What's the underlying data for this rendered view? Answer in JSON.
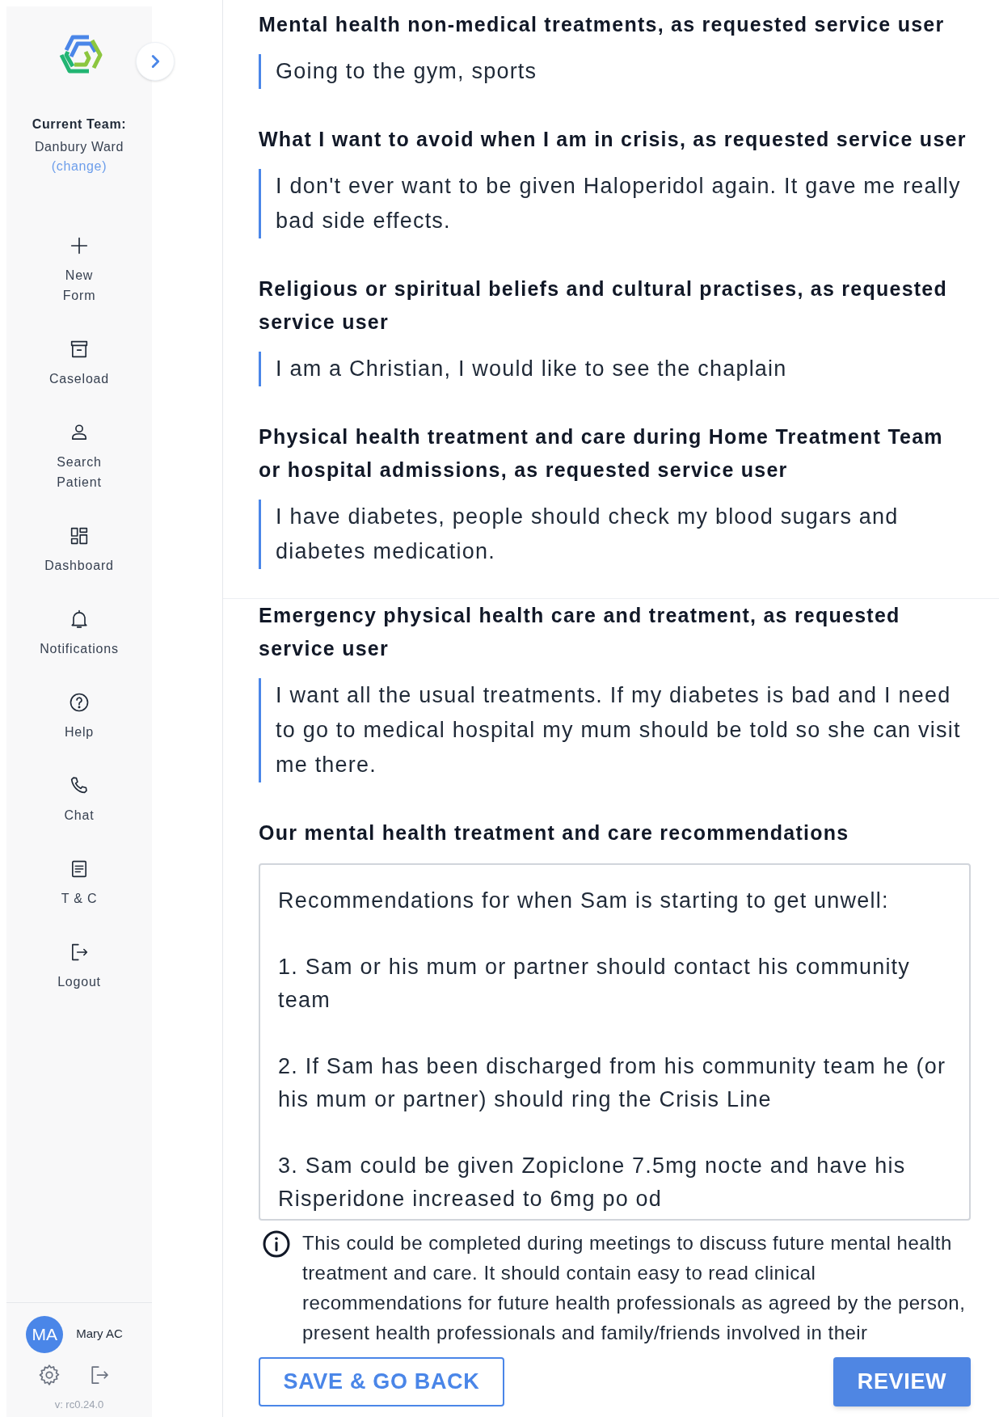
{
  "sidebar": {
    "team_label": "Current Team:",
    "team_name": "Danbury Ward",
    "change_link": "(change)",
    "nav": [
      {
        "kind": "plus",
        "lines": [
          "New",
          "Form"
        ]
      },
      {
        "kind": "archive",
        "lines": [
          "Caseload"
        ]
      },
      {
        "kind": "user",
        "lines": [
          "Search",
          "Patient"
        ]
      },
      {
        "kind": "dashboard",
        "lines": [
          "Dashboard"
        ]
      },
      {
        "kind": "bell",
        "lines": [
          "Notifications"
        ]
      },
      {
        "kind": "help",
        "lines": [
          "Help"
        ]
      },
      {
        "kind": "phone",
        "lines": [
          "Chat"
        ]
      },
      {
        "kind": "document",
        "lines": [
          "T & C"
        ]
      },
      {
        "kind": "logout",
        "lines": [
          "Logout"
        ]
      }
    ],
    "user": {
      "initials": "MA",
      "name": "Mary AC"
    },
    "version": "v: rc0.24.0"
  },
  "sections": [
    {
      "heading": "Mental health non-medical treatments, as requested service user",
      "answer": "Going to the gym, sports"
    },
    {
      "heading": "What I want to avoid when I am in crisis, as requested service user",
      "answer": "I don't ever want to be given Haloperidol again. It gave me really bad side effects."
    },
    {
      "heading": "Religious or spiritual beliefs and cultural practises, as requested service user",
      "answer": "I am a Christian, I would like to see the chaplain"
    },
    {
      "heading": "Physical health treatment and care during Home Treatment Team or hospital admissions, as requested service user",
      "answer": "I have diabetes, people should check my blood sugars and diabetes medication."
    },
    {
      "heading": "Emergency physical health care and treatment, as requested service user",
      "answer": "I want all the usual treatments. If my diabetes is bad and I need to go to medical hospital my mum should be told so she can visit me there."
    }
  ],
  "recommendations": {
    "heading": "Our mental health treatment and care recommendations",
    "value": "Recommendations for when Sam is starting to get unwell:\n\n1. Sam or his mum or partner should contact his community team\n\n2. If Sam has been discharged from his community team he (or his mum or partner) should ring the Crisis Line\n\n3. Sam could be given Zopiclone 7.5mg nocte and have his Risperidone increased to 6mg po od",
    "info": "This could be completed during meetings to discuss future mental health treatment and care. It should contain easy to read clinical recommendations for future health professionals as agreed by the person, present health professionals and family/friends involved in their"
  },
  "buttons": {
    "back": "SAVE & GO BACK",
    "review": "REVIEW"
  }
}
